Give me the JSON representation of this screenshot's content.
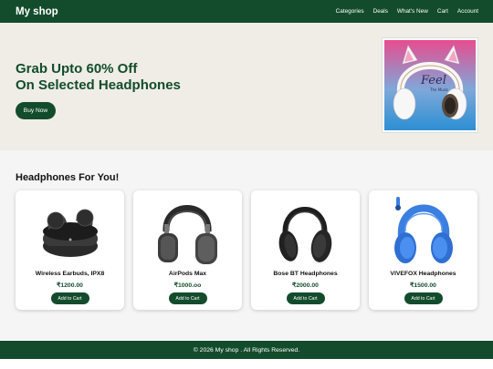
{
  "header": {
    "logo": "My shop",
    "nav": [
      "Categories",
      "Deals",
      "What's New",
      "Cart",
      "Account"
    ]
  },
  "hero": {
    "title_line1": "Grab Upto 60% Off",
    "title_line2": "On Selected Headphones",
    "button_label": "Buy Now",
    "image_icon": "white-cat-ear-headphones-image",
    "image_text": "Feel",
    "image_subtext": "The Music"
  },
  "products": {
    "title": "Headphones For You!",
    "items": [
      {
        "name": "Wireless Earbuds, IPX8",
        "price": "₹1200.00",
        "button": "Add to Cart",
        "icon": "earbuds-image"
      },
      {
        "name": "AirPods Max",
        "price": "₹1000.oo",
        "button": "Add to Cart",
        "icon": "airpods-max-image"
      },
      {
        "name": "Bose BT Headphones",
        "price": "₹2000.00",
        "button": "Add to Cart",
        "icon": "bose-headphones-image"
      },
      {
        "name": "VIVEFOX Headphones",
        "price": "₹1500.00",
        "button": "Add to Cart",
        "icon": "blue-headphones-image"
      }
    ]
  },
  "footer": {
    "text": "© 2026 My shop . All Rights Reserved."
  },
  "colors": {
    "brand": "#134c2c",
    "hero_bg": "#efede6",
    "section_bg": "#f5f5f5"
  }
}
